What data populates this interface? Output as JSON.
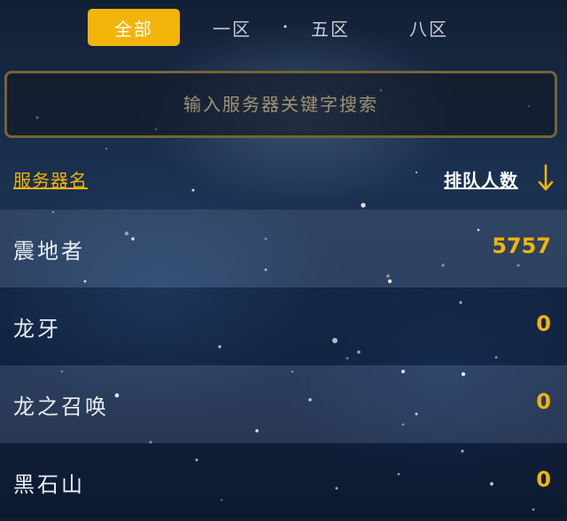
{
  "tabs": [
    {
      "label": "全部",
      "active": true
    },
    {
      "label": "一区",
      "active": false
    },
    {
      "label": "五区",
      "active": false
    },
    {
      "label": "八区",
      "active": false
    }
  ],
  "search": {
    "placeholder": "输入服务器关键字搜索",
    "value": ""
  },
  "header": {
    "server_name_label": "服务器名",
    "queue_label": "排队人数",
    "sort_icon": "arrow-down-icon",
    "sort_direction": "descending"
  },
  "servers": [
    {
      "name": "震地者",
      "queue": "5757"
    },
    {
      "name": "龙牙",
      "queue": "0"
    },
    {
      "name": "龙之召唤",
      "queue": "0"
    },
    {
      "name": "黑石山",
      "queue": "0"
    }
  ],
  "colors": {
    "accent": "#f2b409",
    "search_border": "#736338"
  }
}
